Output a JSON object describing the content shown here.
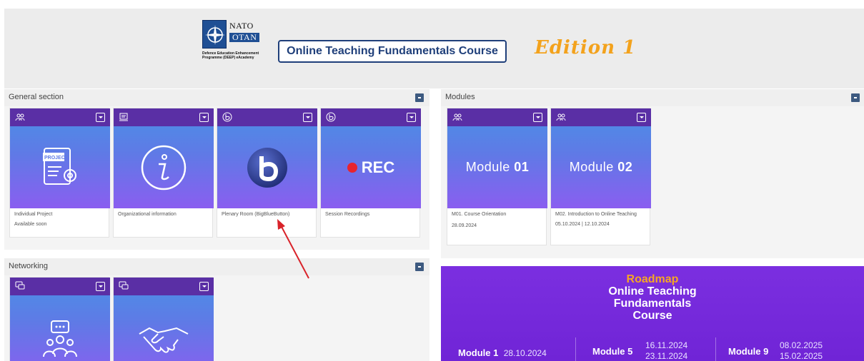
{
  "banner": {
    "nato_top": "NATO",
    "nato_bottom": "OTAN",
    "deep_lines": "Defence Education Enhancement Programme (DEEP) eAcademy",
    "course_title": "Online Teaching Fundamentals Course",
    "edition": "Edition 1"
  },
  "general": {
    "title": "General section",
    "cards": [
      {
        "bar_icon": "users-icon",
        "art": "project-document-icon",
        "label": "Individual Project",
        "sub": "Available soon"
      },
      {
        "bar_icon": "laptop-icon",
        "art": "info-icon",
        "label": "Organizational information",
        "sub": ""
      },
      {
        "bar_icon": "bbb-icon",
        "art": "bigbluebutton-logo",
        "label": "Plenary Room (BigBlueButton)",
        "sub": ""
      },
      {
        "bar_icon": "bbb-icon",
        "art": "rec-badge",
        "rec_text": "REC",
        "label": "Session Recordings",
        "sub": ""
      }
    ]
  },
  "modules": {
    "title": "Modules",
    "cards": [
      {
        "bar_icon": "users-icon",
        "art_prefix": "Module ",
        "art_num": "01",
        "label": "M01. Course Orientation",
        "sub": "28.09.2024"
      },
      {
        "bar_icon": "users-icon",
        "art_prefix": "Module ",
        "art_num": "02",
        "label": "M02. Introduction to Online Teaching",
        "sub": "05.10.2024 | 12.10.2024"
      }
    ]
  },
  "networking": {
    "title": "Networking",
    "cards": [
      {
        "bar_icon": "chat-icon",
        "art": "group-chat-icon"
      },
      {
        "bar_icon": "chat-icon",
        "art": "handshake-icon"
      }
    ]
  },
  "roadmap": {
    "heading": "Roadmap",
    "title_line1": "Online Teaching",
    "title_line2": "Fundamentals",
    "title_line3": "Course",
    "items": [
      {
        "module": "Module 1",
        "date": "28.10.2024",
        "date2": ""
      },
      {
        "module": "Module 5",
        "date": "16.11.2024",
        "date2": "23.11.2024"
      },
      {
        "module": "Module 9",
        "date": "08.02.2025",
        "date2": "15.02.2025"
      }
    ]
  },
  "colors": {
    "bar": "#5a2fa5",
    "accent_orange": "#f3a21c",
    "title_blue": "#1f3f7a",
    "roadmap_bg": "#7b2fe0"
  }
}
